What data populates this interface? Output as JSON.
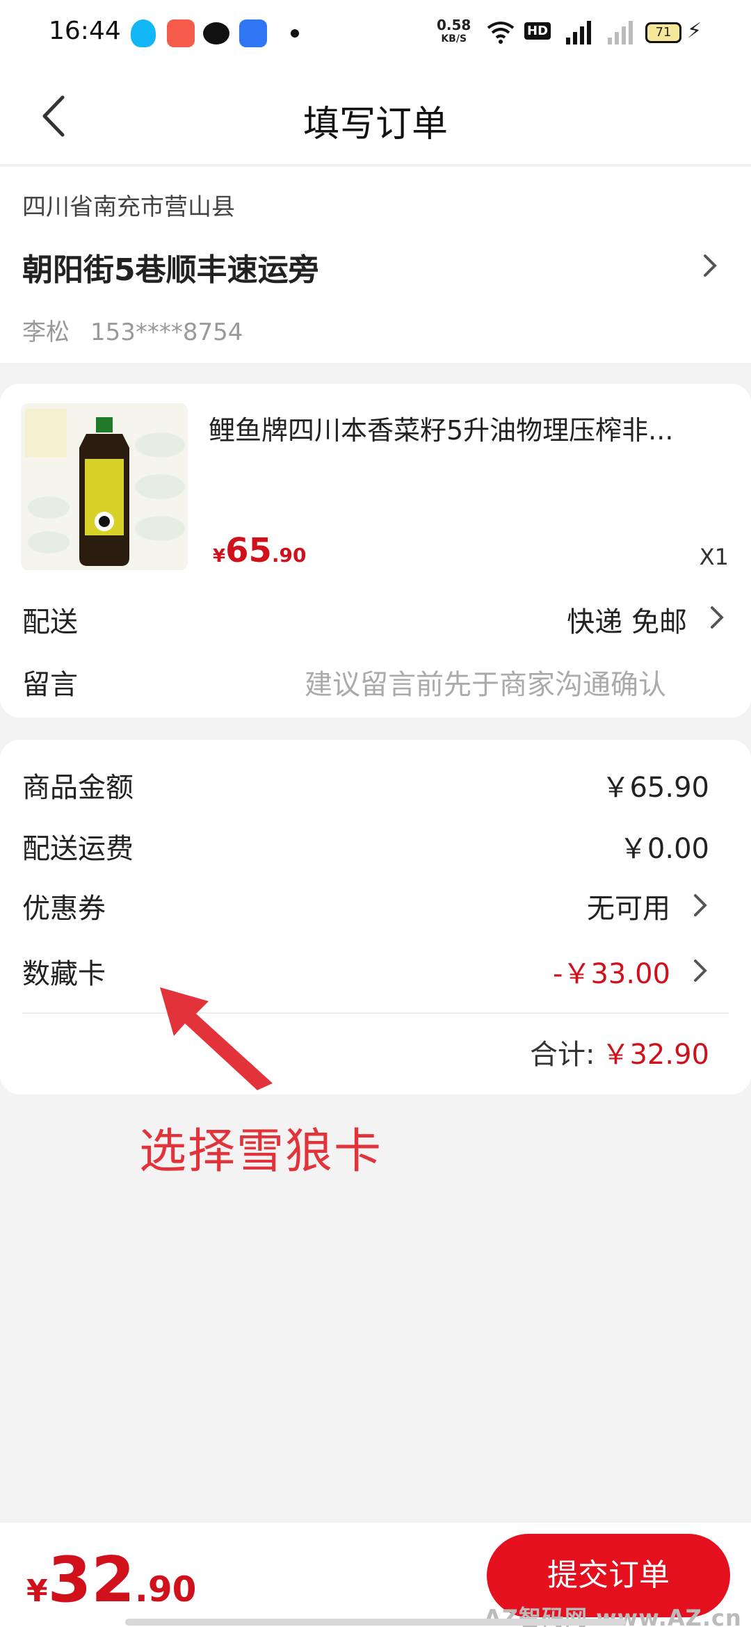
{
  "status_bar": {
    "time": "16:44",
    "net_speed": "0.58",
    "net_unit": "KB/S",
    "hd_label": "HD",
    "battery": "71",
    "icons": [
      "qq-icon",
      "video-app-icon",
      "wechat-icon",
      "infinity-app-icon",
      "wifi-icon",
      "signal-icon",
      "battery-icon",
      "charging-icon"
    ]
  },
  "header": {
    "title": "填写订单"
  },
  "address": {
    "region": "四川省南充市营山县",
    "street": "朝阳街5巷顺丰速运旁",
    "name": "李松",
    "phone": "153****8754"
  },
  "product": {
    "name": "鲤鱼牌四川本香菜籽5升油物理压榨非...",
    "price_currency": "¥",
    "price_int": "65",
    "price_dec": ".90",
    "quantity": "X1",
    "image_label": "菜籽油"
  },
  "shipping": {
    "label": "配送",
    "value": "快递 免邮"
  },
  "message": {
    "label": "留言",
    "placeholder": "建议留言前先于商家沟通确认"
  },
  "summary": {
    "goods_label": "商品金额",
    "goods_value": "￥65.90",
    "freight_label": "配送运费",
    "freight_value": "￥0.00",
    "coupon_label": "优惠券",
    "coupon_value": "无可用",
    "card_label": "数藏卡",
    "card_value": "-￥33.00",
    "total_label": "合计:",
    "total_value": "￥32.90"
  },
  "annotation": {
    "text": "选择雪狼卡"
  },
  "bottom": {
    "currency": "¥",
    "int": "32",
    "dec": ".90",
    "submit_label": "提交订单",
    "watermark": "AZ智码网 www.AZ.cn"
  },
  "colors": {
    "accent_red": "#d0111b",
    "button_red": "#e5101e",
    "annotation_red": "#e2333b"
  }
}
